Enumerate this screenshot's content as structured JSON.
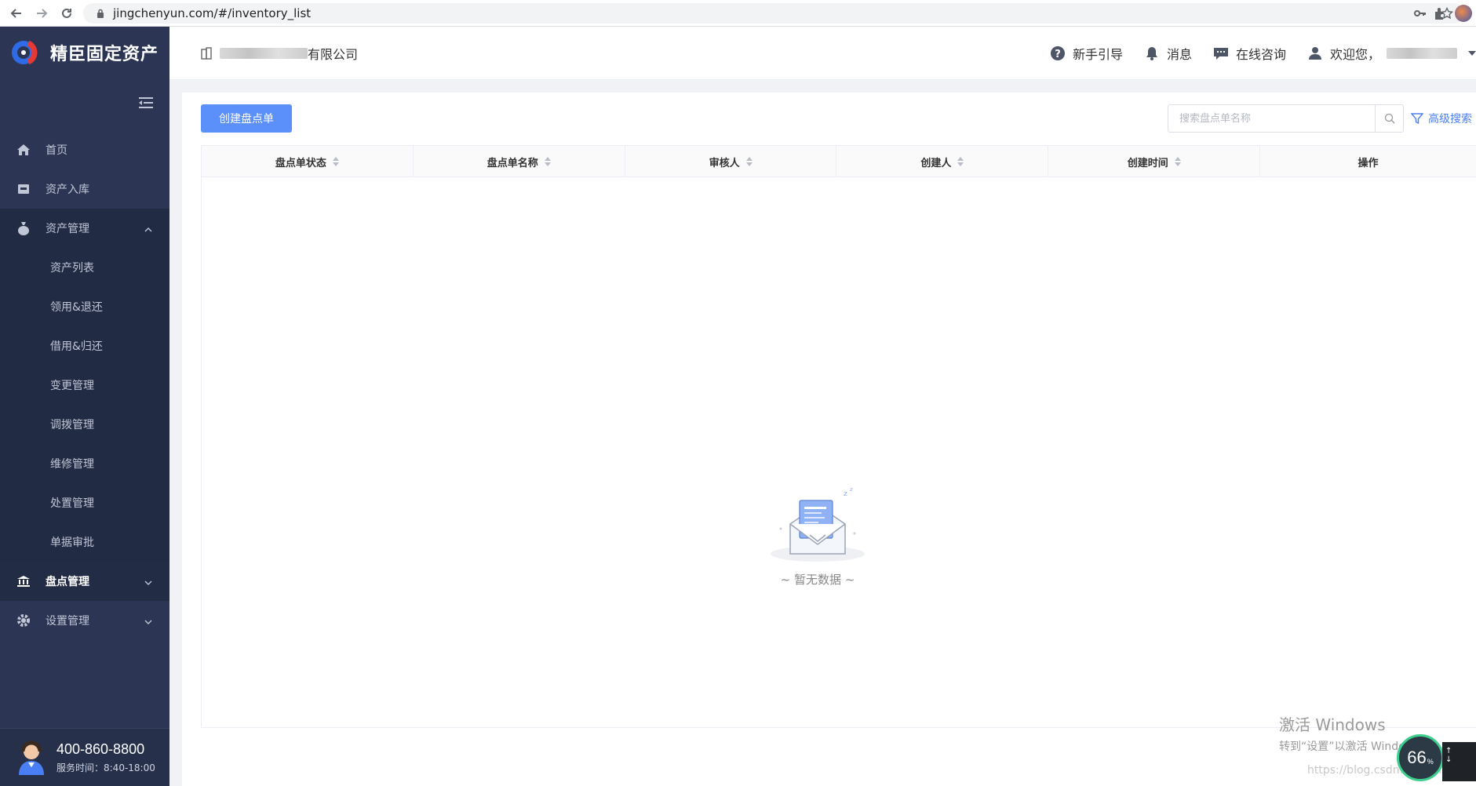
{
  "browser": {
    "url": "jingchenyun.com/#/inventory_list"
  },
  "sidebar": {
    "logo_text": "精臣固定资产",
    "items": [
      {
        "label": "首页",
        "icon": "home-icon"
      },
      {
        "label": "资产入库",
        "icon": "inbox-icon"
      },
      {
        "label": "资产管理",
        "icon": "money-bag-icon",
        "expanded": true
      },
      {
        "label": "盘点管理",
        "icon": "bank-icon",
        "active": true
      },
      {
        "label": "设置管理",
        "icon": "gear-icon"
      }
    ],
    "sub_items": [
      "资产列表",
      "领用&退还",
      "借用&归还",
      "变更管理",
      "调拨管理",
      "维修管理",
      "处置管理",
      "单据审批"
    ],
    "phone": "400-860-8800",
    "service_hours": "服务时间：8:40-18:00"
  },
  "header": {
    "company_suffix": "有限公司",
    "guide": "新手引导",
    "messages": "消息",
    "consult": "在线咨询",
    "welcome": "欢迎您，"
  },
  "toolbar": {
    "create_label": "创建盘点单",
    "search_placeholder": "搜索盘点单名称",
    "advanced_search": "高级搜索"
  },
  "table": {
    "columns": [
      "盘点单状态",
      "盘点单名称",
      "审核人",
      "创建人",
      "创建时间",
      "操作"
    ],
    "rows": [],
    "empty_text": "~ 暂无数据 ~"
  },
  "overlay": {
    "watermark_title": "激活 Windows",
    "watermark_sub": "转到“设置”以激活 Windows。",
    "blog": "https://blog.csdn.net/doris610",
    "gauge_value": "66",
    "gauge_unit": "%"
  },
  "colors": {
    "sidebar_bg": "#2c3654",
    "primary": "#5b8ff9",
    "link": "#4a7ef5"
  }
}
